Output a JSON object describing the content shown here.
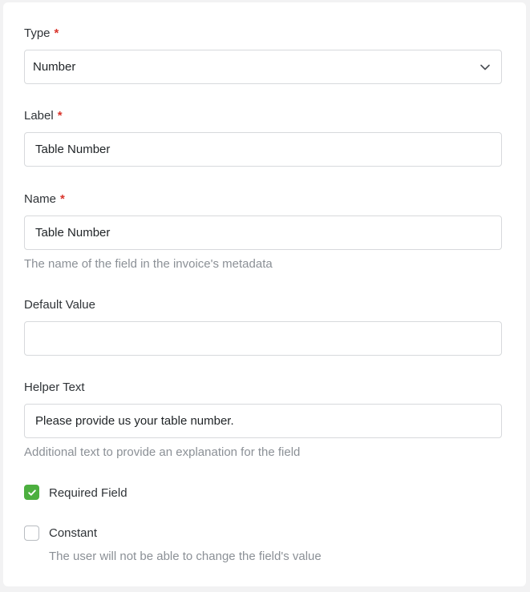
{
  "form": {
    "type": {
      "label": "Type",
      "required_mark": "*",
      "value": "Number"
    },
    "label_field": {
      "label": "Label",
      "required_mark": "*",
      "value": "Table Number"
    },
    "name_field": {
      "label": "Name",
      "required_mark": "*",
      "value": "Table Number",
      "helper": "The name of the field in the invoice's metadata"
    },
    "default_value": {
      "label": "Default Value",
      "value": ""
    },
    "helper_text": {
      "label": "Helper Text",
      "value": "Please provide us your table number.",
      "helper": "Additional text to provide an explanation for the field"
    },
    "required_checkbox": {
      "label": "Required Field",
      "checked": true
    },
    "constant_checkbox": {
      "label": "Constant",
      "checked": false,
      "helper": "The user will not be able to change the field's value"
    }
  },
  "colors": {
    "required_asterisk": "#d9342b",
    "checkbox_checked": "#4caf3f",
    "helper_text": "#8b9096",
    "border": "#d7d9dc"
  },
  "icons": {
    "select_chevron": "chevron-down-icon",
    "checkbox_check": "check-icon"
  }
}
